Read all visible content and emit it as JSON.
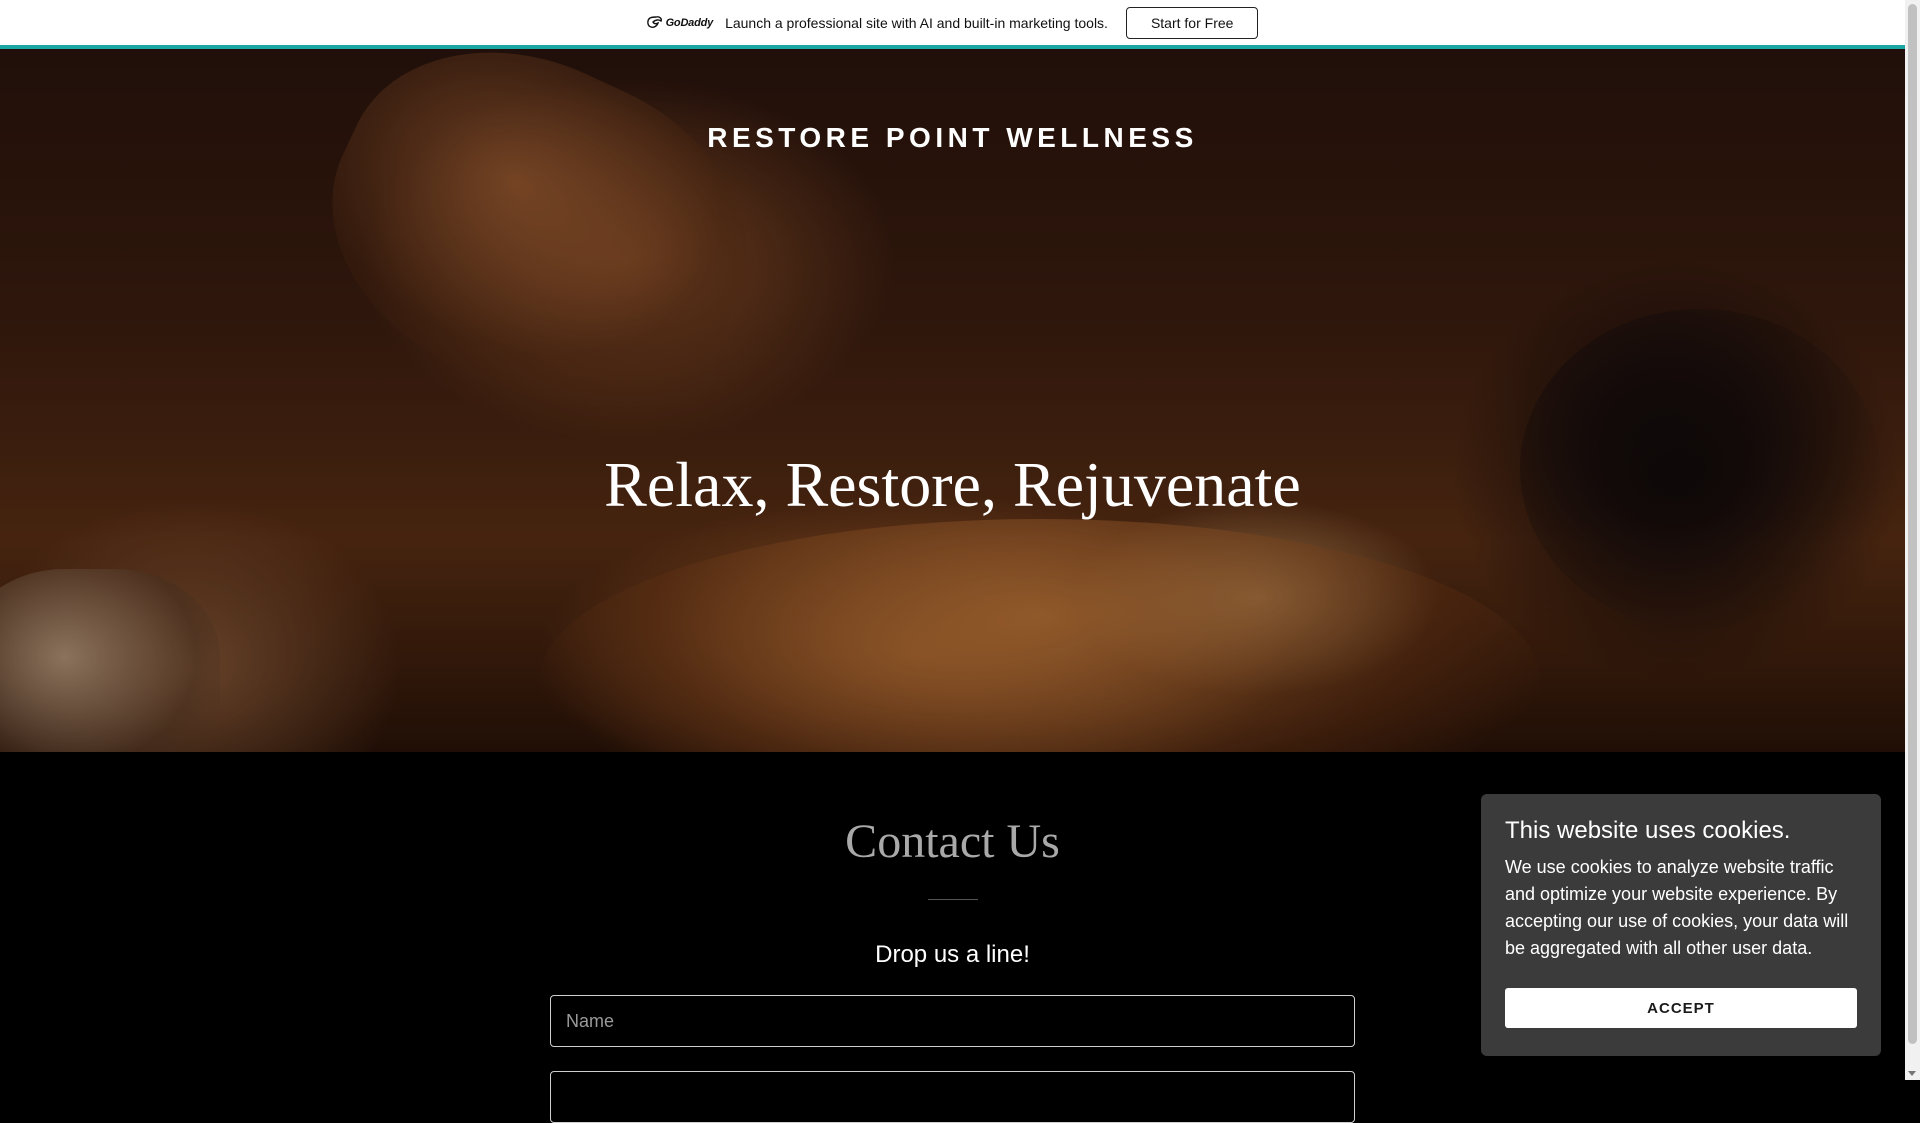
{
  "promo": {
    "logo_text": "GoDaddy",
    "message": "Launch a professional site with AI and built-in marketing tools.",
    "button_label": "Start for Free",
    "accent_color": "#1aa6a2"
  },
  "hero": {
    "site_title": "RESTORE POINT WELLNESS",
    "heading": "Relax, Restore, Rejuvenate"
  },
  "contact": {
    "title": "Contact Us",
    "subtitle": "Drop us a line!",
    "name_placeholder": "Name",
    "email_placeholder": ""
  },
  "cookie": {
    "title": "This website uses cookies.",
    "body": "We use cookies to analyze website traffic and optimize your website experience. By accepting our use of cookies, your data will be aggregated with all other user data.",
    "accept_label": "ACCEPT"
  }
}
